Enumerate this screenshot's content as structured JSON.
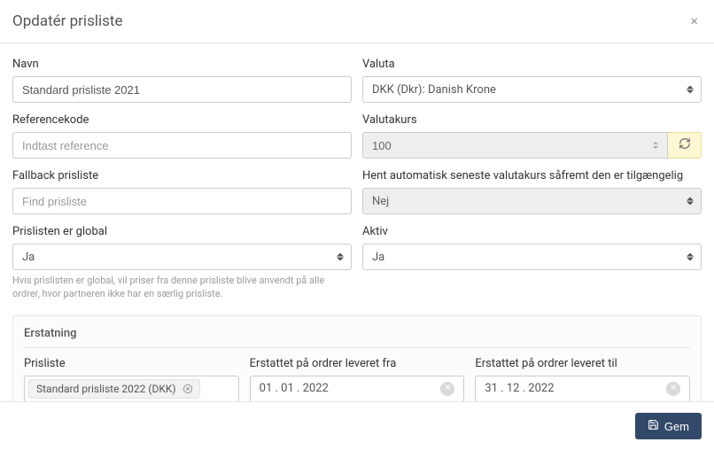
{
  "header": {
    "title": "Opdatér prisliste"
  },
  "fields": {
    "name": {
      "label": "Navn",
      "value": "Standard prisliste 2021"
    },
    "currency": {
      "label": "Valuta",
      "value": "DKK (Dkr): Danish Krone"
    },
    "reference": {
      "label": "Referencekode",
      "placeholder": "Indtast reference"
    },
    "rate": {
      "label": "Valutakurs",
      "value": "100"
    },
    "fallback": {
      "label": "Fallback prisliste",
      "placeholder": "Find prisliste"
    },
    "autofetch": {
      "label": "Hent automatisk seneste valutakurs såfremt den er tilgængelig",
      "value": "Nej"
    },
    "global": {
      "label": "Prislisten er global",
      "value": "Ja",
      "help": "Hvis prislisten er global, vil priser fra denne prisliste blive anvendt på alle ordrer, hvor partneren ikke har en særlig prisliste."
    },
    "active": {
      "label": "Aktiv",
      "value": "Ja"
    }
  },
  "replacement": {
    "title": "Erstatning",
    "pricelist": {
      "label": "Prisliste",
      "value": "Standard prisliste 2022 (DKK)"
    },
    "from": {
      "label": "Erstattet på ordrer leveret fra",
      "value": "01 . 01 . 2022"
    },
    "to": {
      "label": "Erstattet på ordrer leveret til",
      "value": "31 . 12 . 2022"
    }
  },
  "footer": {
    "save": "Gem"
  },
  "colors": {
    "primary": "#33496a",
    "warn_bg": "#fdf7d4"
  }
}
